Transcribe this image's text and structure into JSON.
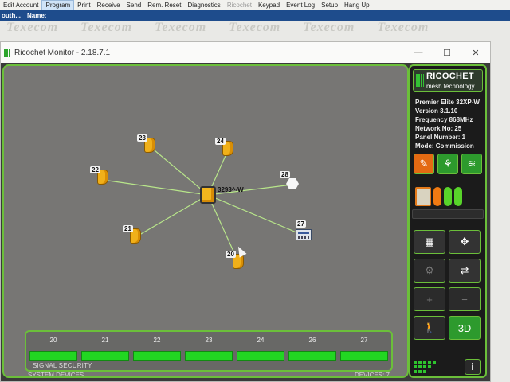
{
  "menubar": {
    "items": [
      {
        "label": "Edit Account",
        "state": "normal"
      },
      {
        "label": "Program",
        "state": "active"
      },
      {
        "label": "Print",
        "state": "normal"
      },
      {
        "label": "Receive",
        "state": "normal"
      },
      {
        "label": "Send",
        "state": "normal"
      },
      {
        "label": "Rem. Reset",
        "state": "normal"
      },
      {
        "label": "Diagnostics",
        "state": "normal"
      },
      {
        "label": "Ricochet",
        "state": "disabled"
      },
      {
        "label": "Keypad",
        "state": "normal"
      },
      {
        "label": "Event Log",
        "state": "normal"
      },
      {
        "label": "Setup",
        "state": "normal"
      },
      {
        "label": "Hang Up",
        "state": "normal"
      }
    ]
  },
  "infobar": {
    "left": "outh...",
    "name_label": "Name:"
  },
  "watermark": {
    "text": "Texecom"
  },
  "window": {
    "title": "Ricochet Monitor - 2.18.7.1",
    "minimize": "—",
    "maximize": "☐",
    "close": "✕"
  },
  "map": {
    "hub": {
      "label": "3293^-W"
    },
    "nodes": [
      {
        "id": "23",
        "type": "detector"
      },
      {
        "id": "24",
        "type": "detector"
      },
      {
        "id": "22",
        "type": "detector"
      },
      {
        "id": "28",
        "type": "siren"
      },
      {
        "id": "27",
        "type": "keypad"
      },
      {
        "id": "21",
        "type": "detector"
      },
      {
        "id": "20",
        "type": "detector"
      }
    ]
  },
  "signal": {
    "columns": [
      "20",
      "21",
      "22",
      "23",
      "24",
      "26",
      "27"
    ],
    "caption": "SIGNAL SECURITY",
    "bar_color": "#22d622"
  },
  "footer": {
    "left": "SYSTEM DEVICES",
    "right": "DEVICES: 7"
  },
  "side": {
    "brand_name": "RICOCHET",
    "brand_sub": "mesh technology",
    "panel_model": "Premier Elite 32XP-W",
    "version": "Version 3.1.10",
    "frequency": "Frequency 868MHz",
    "network": "Network No: 25",
    "panel_number": "Panel Number: 1",
    "mode": "Mode: Commission",
    "info_button": "i",
    "three_d_button": "3D"
  },
  "colors": {
    "accent": "#6bbf3a",
    "node": "#f0b01a",
    "link": "#b8e68a"
  }
}
